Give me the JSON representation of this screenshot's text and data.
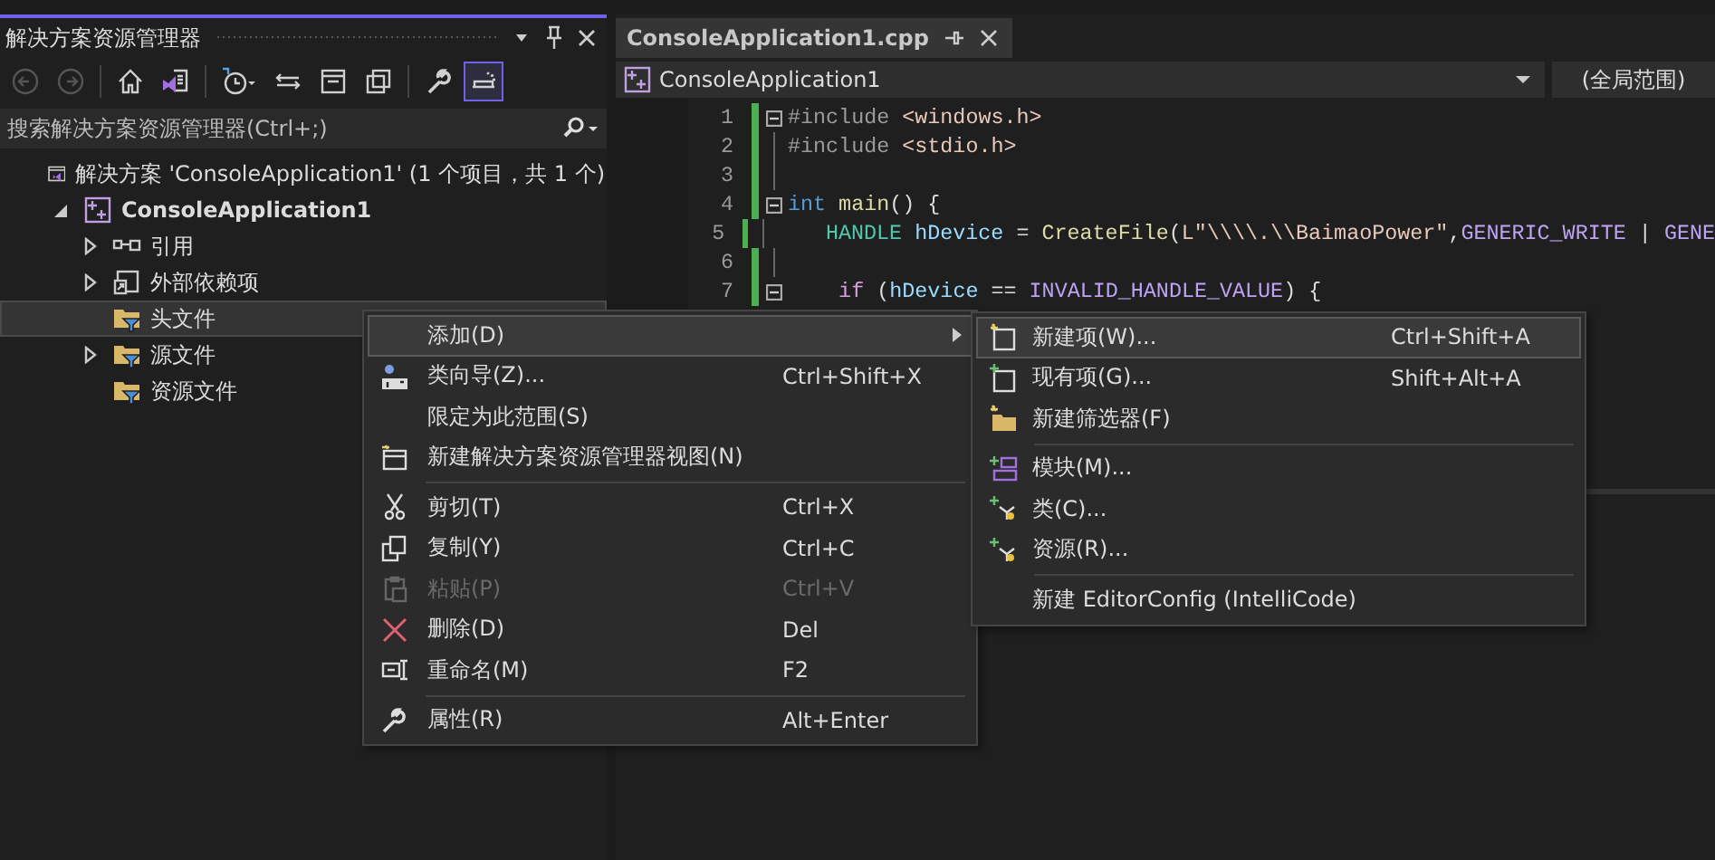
{
  "explorer": {
    "title": "解决方案资源管理器",
    "toolbar": [
      {
        "disabled": true,
        "selected": false
      },
      {
        "disabled": true,
        "selected": false
      },
      {
        "disabled": false,
        "selected": false
      },
      {
        "disabled": false,
        "selected": false
      },
      {
        "disabled": false,
        "selected": false
      },
      {
        "disabled": false,
        "selected": false
      },
      {
        "disabled": false,
        "selected": false
      },
      {
        "disabled": false,
        "selected": false
      },
      {
        "disabled": false,
        "selected": false
      },
      {
        "disabled": false,
        "selected": true
      }
    ],
    "search": {
      "placeholder": "搜索解决方案资源管理器(Ctrl+;)"
    },
    "tree": [
      {
        "kind": "solution",
        "label": "解决方案 'ConsoleApplication1' (1 个项目，共 1 个)",
        "selected": false,
        "children": [
          {
            "kind": "project",
            "label": "ConsoleApplication1",
            "selected": false,
            "expanded": true,
            "children": [
              {
                "kind": "references",
                "label": "引用",
                "selected": false,
                "expanded": false
              },
              {
                "kind": "external",
                "label": "外部依赖项",
                "selected": false,
                "expanded": false
              },
              {
                "kind": "filter",
                "label": "头文件",
                "selected": true
              },
              {
                "kind": "filter",
                "label": "源文件",
                "selected": false,
                "expanded": false
              },
              {
                "kind": "filter",
                "label": "资源文件",
                "selected": false
              }
            ]
          }
        ]
      }
    ]
  },
  "editor": {
    "tabs": [
      {
        "label": "ConsoleApplication1.cpp",
        "selected": true
      }
    ],
    "nav": {
      "scope": "ConsoleApplication1",
      "member": "(全局范围)"
    },
    "lines": [
      {
        "number": "1",
        "fold": true,
        "tokens": [
          {
            "kind": "directive",
            "text": "#include"
          },
          {
            "kind": "string",
            "text": " <windows.h>"
          }
        ]
      },
      {
        "number": "2",
        "fold": false,
        "tokens": [
          {
            "kind": "directive",
            "text": "#include"
          },
          {
            "kind": "string",
            "text": " <stdio.h>"
          }
        ]
      },
      {
        "number": "3",
        "fold": false
      },
      {
        "number": "4",
        "fold": true,
        "tokens": [
          {
            "kind": "keyword",
            "text": "int"
          },
          {
            "kind": "function",
            "text": " main"
          },
          {
            "kind": "plain",
            "text": "() {"
          }
        ]
      },
      {
        "number": "5",
        "fold": false,
        "tokens": [
          {
            "kind": "type",
            "text": "    HANDLE"
          },
          {
            "kind": "variable",
            "text": " hDevice"
          },
          {
            "kind": "plain",
            "text": " = "
          },
          {
            "kind": "function",
            "text": "CreateFile"
          },
          {
            "kind": "plain",
            "text": "("
          },
          {
            "kind": "string",
            "text": "L\"\\\\\\\\.\\\\BaimaoPower\""
          },
          {
            "kind": "plain",
            "text": ","
          },
          {
            "kind": "macro",
            "text": "GENERIC_WRITE"
          },
          {
            "kind": "plain",
            "text": " | "
          },
          {
            "kind": "macro",
            "text": "GENE"
          }
        ]
      },
      {
        "number": "6",
        "fold": false
      },
      {
        "number": "7",
        "fold": true,
        "tokens": [
          {
            "kind": "control",
            "text": "    if"
          },
          {
            "kind": "plain",
            "text": " ("
          },
          {
            "kind": "variable",
            "text": "hDevice"
          },
          {
            "kind": "plain",
            "text": " == "
          },
          {
            "kind": "macro",
            "text": "INVALID_HANDLE_VALUE"
          },
          {
            "kind": "plain",
            "text": ") {"
          }
        ]
      }
    ]
  },
  "context_menu": [
    {
      "kind": "item",
      "label": "添加(D)",
      "submenu": true,
      "selected": true,
      "disabled": false
    },
    {
      "kind": "item",
      "label": "类向导(Z)...",
      "shortcut": "Ctrl+Shift+X",
      "submenu": false,
      "selected": false,
      "disabled": false
    },
    {
      "kind": "item",
      "label": "限定为此范围(S)",
      "submenu": false,
      "selected": false,
      "disabled": false
    },
    {
      "kind": "item",
      "label": "新建解决方案资源管理器视图(N)",
      "submenu": false,
      "selected": false,
      "disabled": false
    },
    {
      "kind": "separator"
    },
    {
      "kind": "item",
      "label": "剪切(T)",
      "shortcut": "Ctrl+X",
      "submenu": false,
      "selected": false,
      "disabled": false
    },
    {
      "kind": "item",
      "label": "复制(Y)",
      "shortcut": "Ctrl+C",
      "submenu": false,
      "selected": false,
      "disabled": false
    },
    {
      "kind": "item",
      "label": "粘贴(P)",
      "shortcut": "Ctrl+V",
      "submenu": false,
      "selected": false,
      "disabled": true
    },
    {
      "kind": "item",
      "label": "删除(D)",
      "shortcut": "Del",
      "submenu": false,
      "selected": false,
      "disabled": false
    },
    {
      "kind": "item",
      "label": "重命名(M)",
      "shortcut": "F2",
      "submenu": false,
      "selected": false,
      "disabled": false
    },
    {
      "kind": "separator"
    },
    {
      "kind": "item",
      "label": "属性(R)",
      "shortcut": "Alt+Enter",
      "submenu": false,
      "selected": false,
      "disabled": false
    }
  ],
  "submenu": [
    {
      "kind": "item",
      "label": "新建项(W)...",
      "shortcut": "Ctrl+Shift+A",
      "selected": true,
      "disabled": false
    },
    {
      "kind": "item",
      "label": "现有项(G)...",
      "shortcut": "Shift+Alt+A",
      "selected": false,
      "disabled": false
    },
    {
      "kind": "item",
      "label": "新建筛选器(F)",
      "selected": false,
      "disabled": false
    },
    {
      "kind": "separator"
    },
    {
      "kind": "item",
      "label": "模块(M)...",
      "selected": false,
      "disabled": false
    },
    {
      "kind": "item",
      "label": "类(C)...",
      "selected": false,
      "disabled": false
    },
    {
      "kind": "item",
      "label": "资源(R)...",
      "selected": false,
      "disabled": false
    },
    {
      "kind": "separator"
    },
    {
      "kind": "item",
      "label": "新建 EditorConfig (IntelliCode)",
      "selected": false,
      "disabled": false
    }
  ]
}
